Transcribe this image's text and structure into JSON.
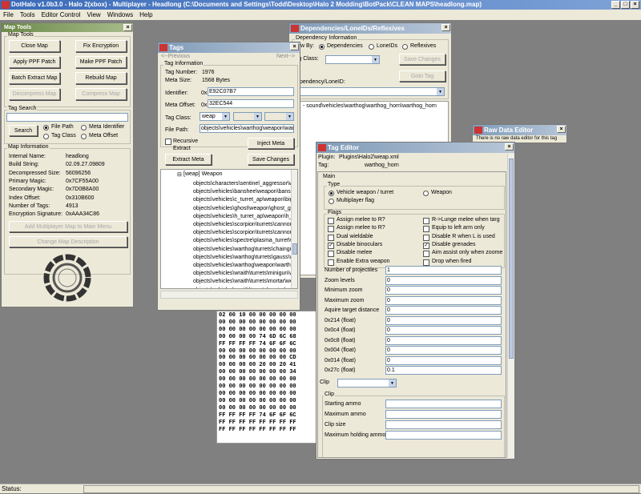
{
  "app": {
    "title": "DotHalo v1.0b3.0 - Halo 2(xbox) - Multiplayer - Headlong (C:\\Documents and Settings\\Todd\\Desktop\\Halo 2 Modding\\BotPack\\CLEAN MAPS\\headlong.map)",
    "status": "Status:"
  },
  "menu": [
    "File",
    "Tools",
    "Editor Control",
    "View",
    "Windows",
    "Help"
  ],
  "maptools": {
    "title": "Map Tools",
    "group": "Map Tools",
    "buttons": {
      "close": "Close Map",
      "fix": "Fix Encryption",
      "apply": "Apply PPF Patch",
      "make": "Make PPF Patch",
      "batch": "Batch Extract Map",
      "rebuild": "Rebuild Map",
      "decompress": "Decompress Map",
      "compress": "Compress Map"
    },
    "search_group": "Tag Search",
    "search_btn": "Search",
    "radios": {
      "file_path": "File Path",
      "meta_id": "Meta Identifier",
      "tag_class": "Tag Class",
      "meta_offset": "Meta Offset"
    },
    "info_group": "Map Information",
    "info": [
      [
        "Internal Name:",
        "headlong"
      ],
      [
        "Build String:",
        "02.09.27.09809"
      ],
      [
        "Decompressed Size:",
        "56096256"
      ],
      [
        "Primary Magic:",
        "0x7CF55A00"
      ],
      [
        "Secondary Magic:",
        "0x7D0B8A00"
      ],
      [
        "Index Offset:",
        "0x310B600"
      ],
      [
        "Number of Tags:",
        "4913"
      ],
      [
        "Encryption Signature:",
        "0xAAA34C86"
      ]
    ],
    "add_mp": "Add Multiplayer Map to Main Menu",
    "change_desc": "Change Map Description"
  },
  "tags": {
    "title": "Tags",
    "prev": "<--Previous",
    "next": "Next-->",
    "info_group": "Tag Information",
    "tag_number_lbl": "Tag Number:",
    "tag_number": "1976",
    "meta_size_lbl": "Meta Size:",
    "meta_size": "1568 Bytes",
    "identifier_lbl": "Identifier:",
    "identifier_pre": "0x",
    "identifier": "E92C07B7",
    "meta_offset_lbl": "Meta Offset:",
    "meta_offset_pre": "0x",
    "meta_offset": "32EC544",
    "tag_class_lbl": "Tag Class:",
    "tag_class": "weap",
    "file_path_lbl": "File Path:",
    "file_path": "objects\\vehicles\\warthog\\weapon\\warthog_horn",
    "recursive": "Recursive Extract",
    "inject": "Inject Meta",
    "extract": "Extract Meta",
    "save": "Save Changes",
    "tree_root": "[weap] Weapon",
    "tree_items": [
      "objects\\characters\\sentinel_aggressor\\weapon",
      "objects\\vehicles\\banshee\\weapon\\banshee",
      "objects\\vehicles\\c_turret_ap\\weapon\\big_needler",
      "objects\\vehicles\\ghost\\weapon\\ghost_gun",
      "objects\\vehicles\\h_turret_ap\\weapon\\h_turret",
      "objects\\vehicles\\scorpion\\turrets\\cannon\\cannon",
      "objects\\vehicles\\scorpion\\turrets\\cannon\\mg",
      "objects\\vehicles\\spectre\\plasma_turret\\weapon",
      "objects\\vehicles\\warthog\\turrets\\chaingun\\weapon",
      "objects\\vehicles\\warthog\\turrets\\gauss\\weapon",
      "objects\\vehicles\\warthog\\weapon\\warthog_horn",
      "objects\\vehicles\\wraith\\turrets\\minigun\\weapon",
      "objects\\vehicles\\wraith\\turrets\\mortar\\weapon",
      "objects\\vehicles\\wraith\\turrets\\mortar\\mortar"
    ]
  },
  "deps": {
    "title": "Dependencies/LoneIDs/Reflexives",
    "group": "Dependency Information",
    "view_by": "View By:",
    "radios": [
      "Dependencies",
      "LoneIDs",
      "Reflexives"
    ],
    "tag_class": "Tag Class:",
    "save": "Save Changes",
    "goto": "Goto Tag",
    "dep_lbl": "Dependency/LoneID:",
    "item": "- sound\\vehicles\\warthog\\warthog_horn\\warthog_horn"
  },
  "raw": {
    "title": "Raw Data Editor",
    "text": "There is no raw data editor for this tag"
  },
  "hex": {
    "rows": [
      "02 00 10 00 00 00 00 00",
      "00 00 00 00 00 00 00 00",
      "00 00 00 00 00 00 00 00",
      "00 00 00 00 74 6D 6C 68",
      "FF FF FF FF 74 6F 6F 6C",
      "00 00 00 00 00 00 00 00",
      "00 00 00 00 00 00 00 CD",
      "00 00 00 00 20 00 20 41",
      "00 00 00 00 00 00 00 34",
      "00 00 00 00 00 00 00 00",
      "00 00 00 00 00 00 00 00",
      "00 00 00 00 00 00 00 00",
      "00 00 00 00 00 00 00 00",
      "00 00 00 00 00 00 00 00",
      "FF FF FF FF 74 6F 6F 6C",
      "FF FF FF FF FF FF FF FF",
      "FF FF FF FF FF FF FF FF"
    ]
  },
  "editor": {
    "title": "Tag Editor",
    "plugin_lbl": "Plugin:",
    "plugin": "Plugins\\Halo2\\weap.xml",
    "tag_lbl": "Tag:",
    "tag": "warthog_horn",
    "main": "Main",
    "type": "Type",
    "type_opts": [
      "Vehicle weapon / turret",
      "Weapon",
      "Multiplayer flag"
    ],
    "flags": "Flags",
    "flags_left": [
      [
        "Assign melee to R?",
        false
      ],
      [
        "Assign melee to R?",
        false
      ],
      [
        "Dual wieldable",
        false
      ],
      [
        "Disable binoculars",
        true
      ],
      [
        "Disable melee",
        false
      ],
      [
        "Enable Extra weapon",
        false
      ]
    ],
    "flags_right": [
      [
        "R->Lunge melee when targ",
        false
      ],
      [
        "Equip to left arm only",
        false
      ],
      [
        "Disable R when L is used",
        false
      ],
      [
        "Disable grenades",
        true
      ],
      [
        "Aim assist only when zoome",
        false
      ],
      [
        "Drop when fired",
        false
      ]
    ],
    "fields": [
      [
        "Number of projectiles",
        "1"
      ],
      [
        "Zoom levels",
        "0"
      ],
      [
        "Minimum zoom",
        "0"
      ],
      [
        "Maximum zoom",
        "0"
      ],
      [
        "Aquire target distance",
        "0"
      ],
      [
        "0x214 (float)",
        "0"
      ],
      [
        "0x0c4 (float)",
        "0"
      ],
      [
        "0x0c8 (float)",
        "0"
      ],
      [
        "0x004 (float)",
        "0"
      ],
      [
        "0x014 (float)",
        "0"
      ],
      [
        "0x27c (float)",
        "0.1"
      ]
    ],
    "clip_lbl": "Clip",
    "clip_group": "Clip",
    "clip_fields": [
      "Starting ammo",
      "Maximum ammo",
      "Clip size",
      "Maximum holding ammo"
    ]
  }
}
